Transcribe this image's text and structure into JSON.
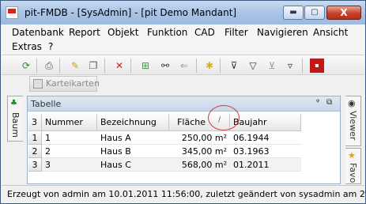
{
  "window": {
    "title": "pit-FMDB - [SysAdmin] - [pit Demo Mandant]",
    "minimize_glyph": "▬",
    "maximize_glyph": "▢",
    "close_glyph": "X"
  },
  "menu": {
    "items": [
      "Datenbank",
      "Report",
      "Objekt",
      "Funktion",
      "CAD",
      "Filter",
      "Navigieren",
      "Ansicht",
      "Extras",
      "?"
    ]
  },
  "toolbar": {
    "icons": [
      "refresh-icon",
      "print-icon",
      "new-document-icon",
      "copy-icon",
      "delete-icon",
      "tree-new-icon",
      "binoculars-icon",
      "back-arrow-icon",
      "sparkle-icon",
      "filter-yes-icon",
      "filter-icon",
      "filter-remove-icon",
      "filter-question-icon",
      "pdf-icon"
    ]
  },
  "karteikarten": {
    "label": "Karteikarten"
  },
  "left_tab": {
    "label": "Baum"
  },
  "right_tabs": [
    {
      "label": "Viewer"
    },
    {
      "label": "Favo"
    }
  ],
  "panel": {
    "title": "Tabelle",
    "pin_glyph": "ᵠ",
    "float_glyph": "⧉"
  },
  "table": {
    "row_count_header": "3",
    "columns": [
      "Nummer",
      "Bezeichnung",
      "Fläche",
      "Baujahr"
    ],
    "sort_indicator": "/",
    "rows": [
      {
        "index": "1",
        "nummer": "1",
        "bezeichnung": "Haus A",
        "flaeche": "250,00 m²",
        "baujahr": "06.1944"
      },
      {
        "index": "2",
        "nummer": "2",
        "bezeichnung": "Haus B",
        "flaeche": "345,00 m²",
        "baujahr": "03.1963"
      },
      {
        "index": "3",
        "nummer": "3",
        "bezeichnung": "Haus C",
        "flaeche": "568,00 m²",
        "baujahr": "01.2011"
      }
    ]
  },
  "status": {
    "text": "Erzeugt von admin am 10.01.2011 11:56:00, zuletzt geändert von sysadmin am 29"
  },
  "colors": {
    "accent": "#d23a3a",
    "title_bar": "#a9c4e6",
    "panel_header": "#c9d7e9"
  }
}
